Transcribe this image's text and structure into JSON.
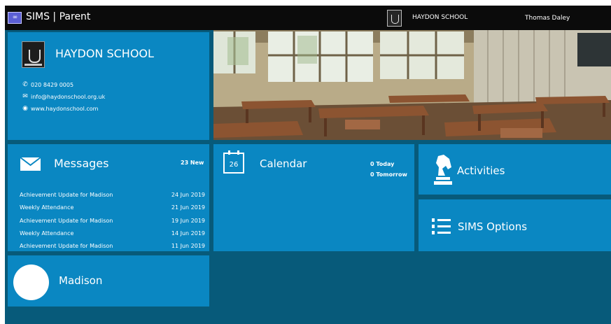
{
  "header": {
    "app_logo": "SIMS",
    "app_title": "SIMS | Parent",
    "school_name": "HAYDON SCHOOL",
    "user_name": "Thomas Daley"
  },
  "school": {
    "name": "HAYDON SCHOOL",
    "phone": "020 8429 0005",
    "email": "info@haydonschool.org.uk",
    "website": "www.haydonschool.com"
  },
  "messages": {
    "title": "Messages",
    "new_count": "23 New",
    "items": [
      {
        "subject": "Achievement Update for Madison",
        "date": "24 Jun 2019"
      },
      {
        "subject": "Weekly Attendance",
        "date": "21 Jun 2019"
      },
      {
        "subject": "Achievement Update for Madison",
        "date": "19 Jun 2019"
      },
      {
        "subject": "Weekly Attendance",
        "date": "14 Jun 2019"
      },
      {
        "subject": "Achievement Update for Madison",
        "date": "11 Jun 2019"
      }
    ]
  },
  "calendar": {
    "title": "Calendar",
    "icon_day": "26",
    "today": "0 Today",
    "tomorrow": "0 Tomorrow"
  },
  "activities": {
    "title": "Activities"
  },
  "options": {
    "title": "SIMS Options"
  },
  "student": {
    "name": "Madison"
  },
  "icons": {
    "phone": "phone-icon",
    "email": "envelope-icon",
    "website": "globe-icon",
    "messages": "envelope-icon",
    "calendar": "calendar-icon",
    "activities": "chess-knight-icon",
    "options": "numbered-list-icon"
  },
  "colors": {
    "tile": "#0a87c2",
    "background": "#075a7a",
    "topbar": "#0b0b0b",
    "logo": "#5b5fd4"
  }
}
